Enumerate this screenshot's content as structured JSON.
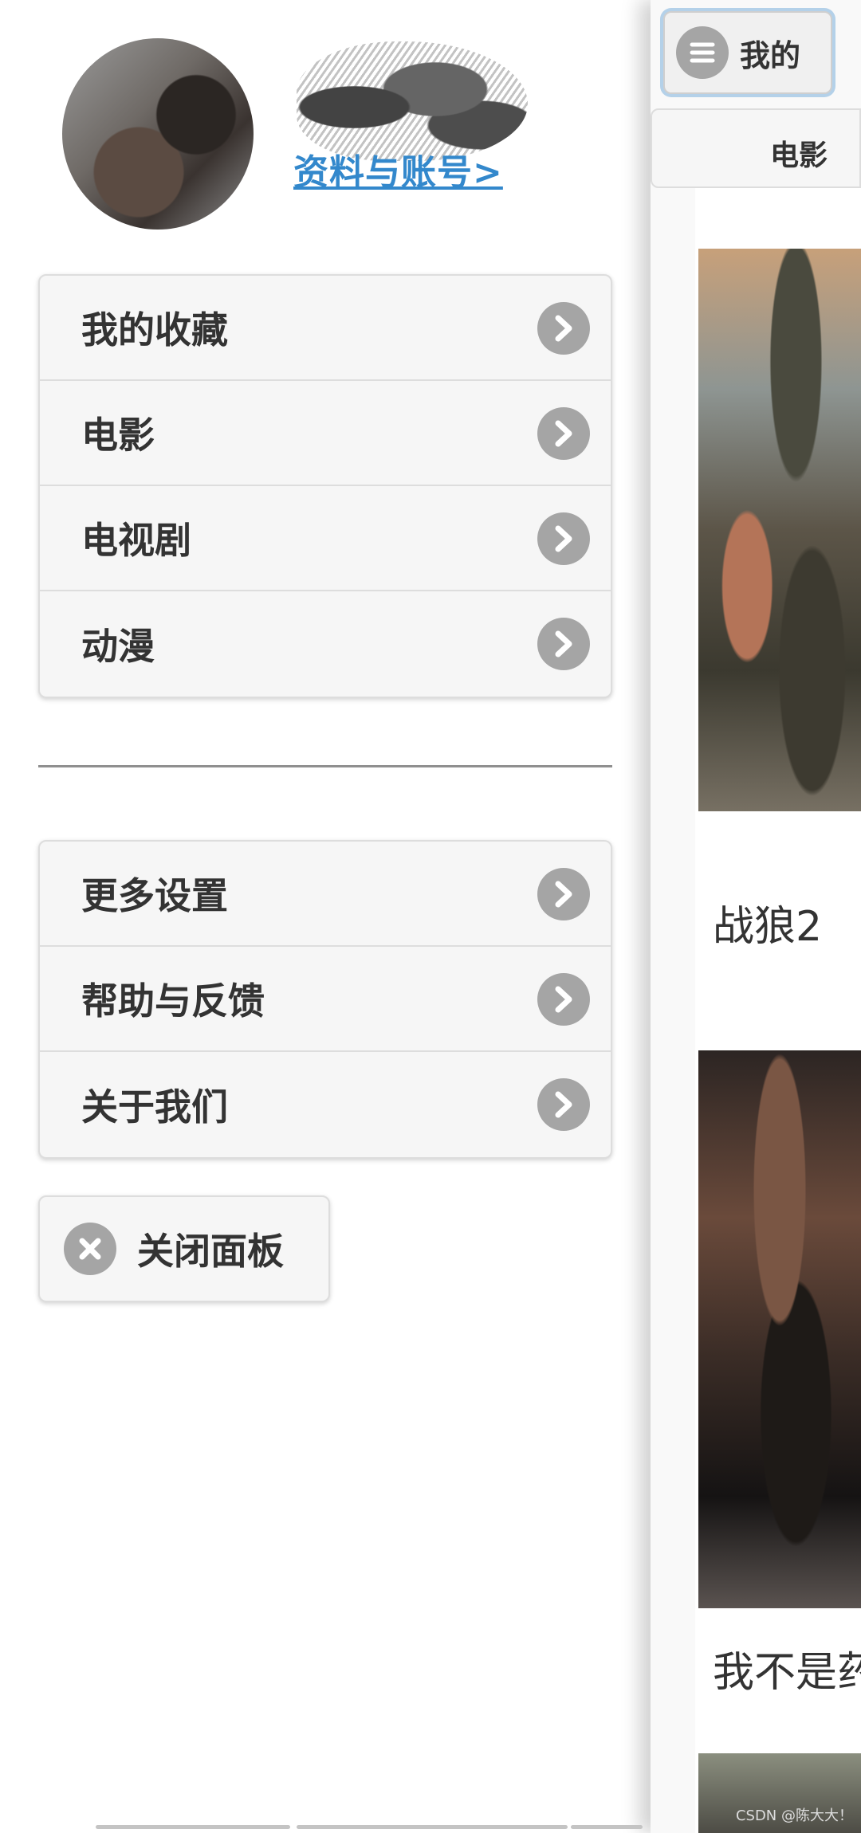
{
  "panel": {
    "profile_link": "资料与账号>",
    "menu_items": [
      {
        "label": "我的收藏",
        "icon": "chevron-right-icon"
      },
      {
        "label": "电影",
        "icon": "chevron-right-icon"
      },
      {
        "label": "电视剧",
        "icon": "chevron-right-icon"
      },
      {
        "label": "动漫",
        "icon": "chevron-right-icon"
      }
    ],
    "settings_items": [
      {
        "label": "更多设置",
        "icon": "chevron-right-icon"
      },
      {
        "label": "帮助与反馈",
        "icon": "chevron-right-icon"
      },
      {
        "label": "关于我们",
        "icon": "chevron-right-icon"
      }
    ],
    "close_button": {
      "label": "关闭面板",
      "icon": "close-icon"
    }
  },
  "page": {
    "menu_button": {
      "label": "我的",
      "icon": "menu-icon"
    },
    "tabs": [
      {
        "label": "电影"
      }
    ],
    "movies": [
      {
        "title": "战狼2"
      },
      {
        "title": "我不是药"
      }
    ],
    "watermark": "CSDN @陈大大！"
  },
  "colors": {
    "link": "#3388cc",
    "icon_circle": "#a5a5a5",
    "list_bg": "#f6f6f6",
    "text": "#333333"
  }
}
